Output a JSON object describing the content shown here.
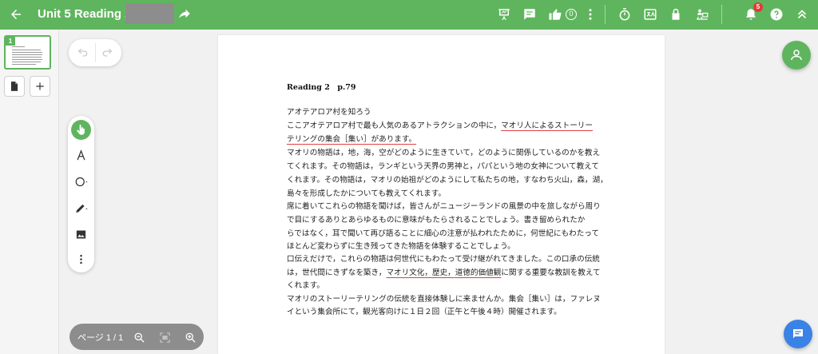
{
  "header": {
    "title": "Unit 5 Reading 2 :",
    "like_count": "0",
    "notification_count": "5",
    "icons": [
      "back-arrow-icon",
      "share-icon",
      "presentation-icon",
      "comment-icon",
      "thumbs-up-icon",
      "more-vert-icon",
      "timer-icon",
      "translate-icon",
      "lock-icon",
      "users-screen-icon",
      "bell-icon",
      "help-icon",
      "collapse-icon"
    ]
  },
  "thumbnails": {
    "page_number": "1"
  },
  "zoom": {
    "page_label": "ページ 1 / 1"
  },
  "document": {
    "heading": "Reading 2　p.79",
    "lines": [
      "アオテアロア村を知ろう",
      "ここアオテアロア村で最も人気のあるアトラクションの中に，",
      "テリングの集会［集い］があります。",
      "マオリの物語は，地，海，空がどのように生きていて，どのように関係しているのかを教え",
      "てくれます。その物語は，ランギという天界の男神と，パパという地の女神について教えて",
      "くれます。その物語は，マオリの始祖がどのようにして私たちの地，すなわち火山，森，湖，",
      "島々を形成したかについても教えてくれます。",
      "席に着いてこれらの物語を聞けば，皆さんがニュージーランドの風景の中を旅しながら周り",
      "で目にするありとあらゆるものに意味がもたらされることでしょう。書き留められたか",
      "らではなく，耳で聞いて再び語ることに細心の注意が払われたために，何世紀にもわたって",
      "ほとんど変わらずに生き残ってきた物語を体験することでしょう。",
      "口伝えだけで，これらの物語は何世代にもわたって受け継がれてきました。この口承の伝統",
      "は，世代間にきずなを築き，",
      "くれます。",
      "マオリのストーリーテリングの伝統を直接体験しに来ませんか。集会［集い］は，ファレヌ",
      "イという集会所にて，観光客向けに１日２回（正午と午後４時）開催されます。"
    ],
    "line2_underlined": "マオリ人によるストーリー",
    "line13_underlined_a": "マオリ文化，歴史，",
    "line13_underlined_b": "道徳的価値観",
    "line13_tail": "に関する重要な教訓を教えて"
  },
  "colors": {
    "topbar": "#5fb55e",
    "accent": "#5fb55e",
    "chat": "#3b82e6",
    "badge": "#e53935",
    "underline": "#e04040"
  }
}
